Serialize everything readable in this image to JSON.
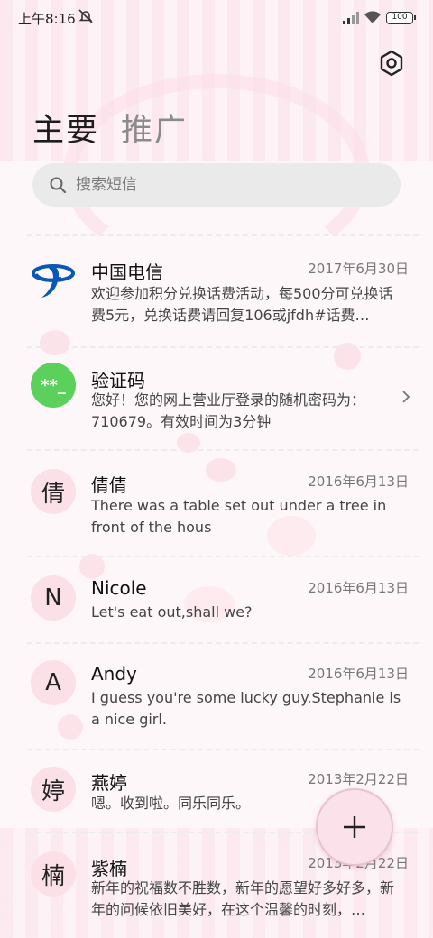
{
  "status_bar": {
    "time": "上午8:16",
    "battery": "100"
  },
  "tabs": {
    "main": "主要",
    "promo": "推广"
  },
  "search": {
    "placeholder": "搜索短信"
  },
  "conversations": [
    {
      "name": "中国电信",
      "avatar": "",
      "date": "2017年6月30日",
      "preview": "欢迎参加积分兑换话费活动，每500分可兑换话费5元，兑换话费请回复106或jfdh#话费…"
    },
    {
      "name": "验证码",
      "avatar": "**_",
      "date": "",
      "preview": "您好！您的网上营业厅登录的随机密码为：710679。有效时间为3分钟"
    },
    {
      "name": "倩倩",
      "avatar": "倩",
      "date": "2016年6月13日",
      "preview": "There was a table set out under a tree in front of the hous"
    },
    {
      "name": "Nicole",
      "avatar": "N",
      "date": "2016年6月13日",
      "preview": "Let's eat out,shall we?"
    },
    {
      "name": "Andy",
      "avatar": "A",
      "date": "2016年6月13日",
      "preview": "I guess you're some lucky guy.Stephanie is a nice girl."
    },
    {
      "name": "燕婷",
      "avatar": "婷",
      "date": "2013年2月22日",
      "preview": "嗯。收到啦。同乐同乐。"
    },
    {
      "name": "紫楠",
      "avatar": "楠",
      "date": "2013年2月22日",
      "preview": "新年的祝福数不胜数，新年的愿望好多好多，新年的问候依旧美好，在这个温馨的时刻，…"
    }
  ],
  "icons": {
    "settings": "settings-hex-icon",
    "search": "search-icon",
    "compose": "plus-icon",
    "telecom": "china-telecom-logo-icon",
    "chevron": "chevron-right-icon"
  },
  "colors": {
    "accent_pink": "#fbe0e8",
    "otp_green": "#5bd05b",
    "telecom_blue": "#0a58b5"
  }
}
